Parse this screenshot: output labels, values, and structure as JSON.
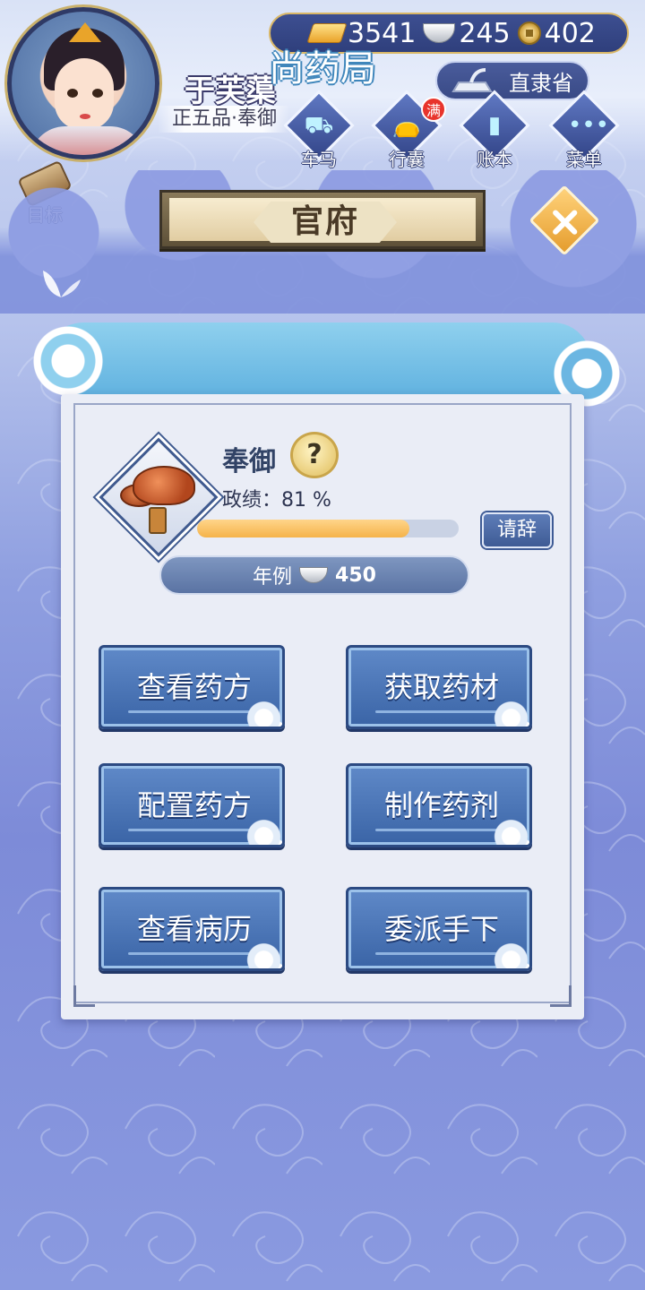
{
  "header": {
    "player_name": "于芙蕖",
    "player_rank": "正五品·奉御",
    "province": "直隶省",
    "currency": {
      "gold": "3541",
      "silver": "245",
      "copper": "402"
    },
    "nav": [
      {
        "label": "车马",
        "icon": "carriage-icon"
      },
      {
        "label": "行囊",
        "icon": "bag-icon",
        "badge": "满"
      },
      {
        "label": "账本",
        "icon": "ledger-icon"
      },
      {
        "label": "菜单",
        "icon": "menu-dots-icon"
      }
    ],
    "goal_label": "目标"
  },
  "plaque": {
    "title": "官府"
  },
  "panel": {
    "title": "尚药局",
    "official_title": "奉御",
    "help_label": "?",
    "performance_label": "政绩：81 %",
    "performance_value": 0.81,
    "resign_label": "请辞",
    "salary_label": "年例",
    "salary_value": "450"
  },
  "actions": [
    {
      "label": "查看药方"
    },
    {
      "label": "获取药材"
    },
    {
      "label": "配置药方"
    },
    {
      "label": "制作药剂"
    },
    {
      "label": "查看病历"
    },
    {
      "label": "委派手下"
    }
  ],
  "colors": {
    "accent_blue": "#3a64a6",
    "progress_fill": "#f5b34a",
    "badge_red": "#e8342c"
  }
}
